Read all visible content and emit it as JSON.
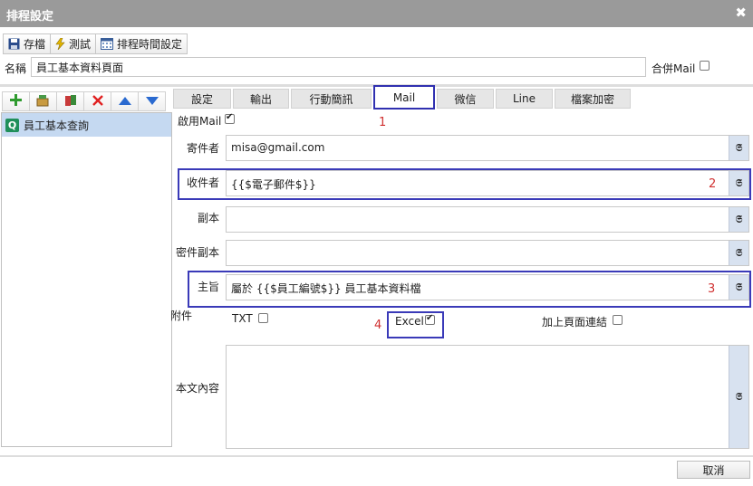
{
  "window": {
    "title": "排程設定",
    "close_glyph": "✖"
  },
  "toolbar": {
    "save": "存檔",
    "test": "測試",
    "schedule": "排程時間設定"
  },
  "name_label": "名稱",
  "name_value": "員工基本資料頁面",
  "merge_mail_label": "合併Mail",
  "merge_mail_checked": false,
  "tree": {
    "item": "員工基本查詢",
    "item_icon_letter": "Q"
  },
  "tabs": [
    "設定",
    "輸出",
    "行動簡訊",
    "Mail",
    "微信",
    "Line",
    "檔案加密"
  ],
  "active_tab": "Mail",
  "mail": {
    "enable_label": "啟用Mail",
    "enable_checked": true,
    "sender_label": "寄件者",
    "sender_value": "misa@gmail.com",
    "to_label": "收件者",
    "to_value": "{{$電子郵件$}}",
    "cc_label": "副本",
    "cc_value": "",
    "bcc_label": "密件副本",
    "bcc_value": "",
    "subject_label": "主旨",
    "subject_value": "屬於 {{$員工編號$}} 員工基本資料檔",
    "attach_label": "附件",
    "txt_label": "TXT",
    "txt_checked": false,
    "excel_label": "Excel",
    "excel_checked": true,
    "add_link_label": "加上頁面連結",
    "add_link_checked": false,
    "body_label": "本文內容",
    "body_value": ""
  },
  "annotations": [
    "1",
    "2",
    "3",
    "4"
  ],
  "cancel_label": "取消",
  "colors": {
    "titlebar": "#9a9a9a",
    "highlight": "#3a3ab8",
    "annotation": "#d03030",
    "selected_row": "#c5d9f1"
  }
}
